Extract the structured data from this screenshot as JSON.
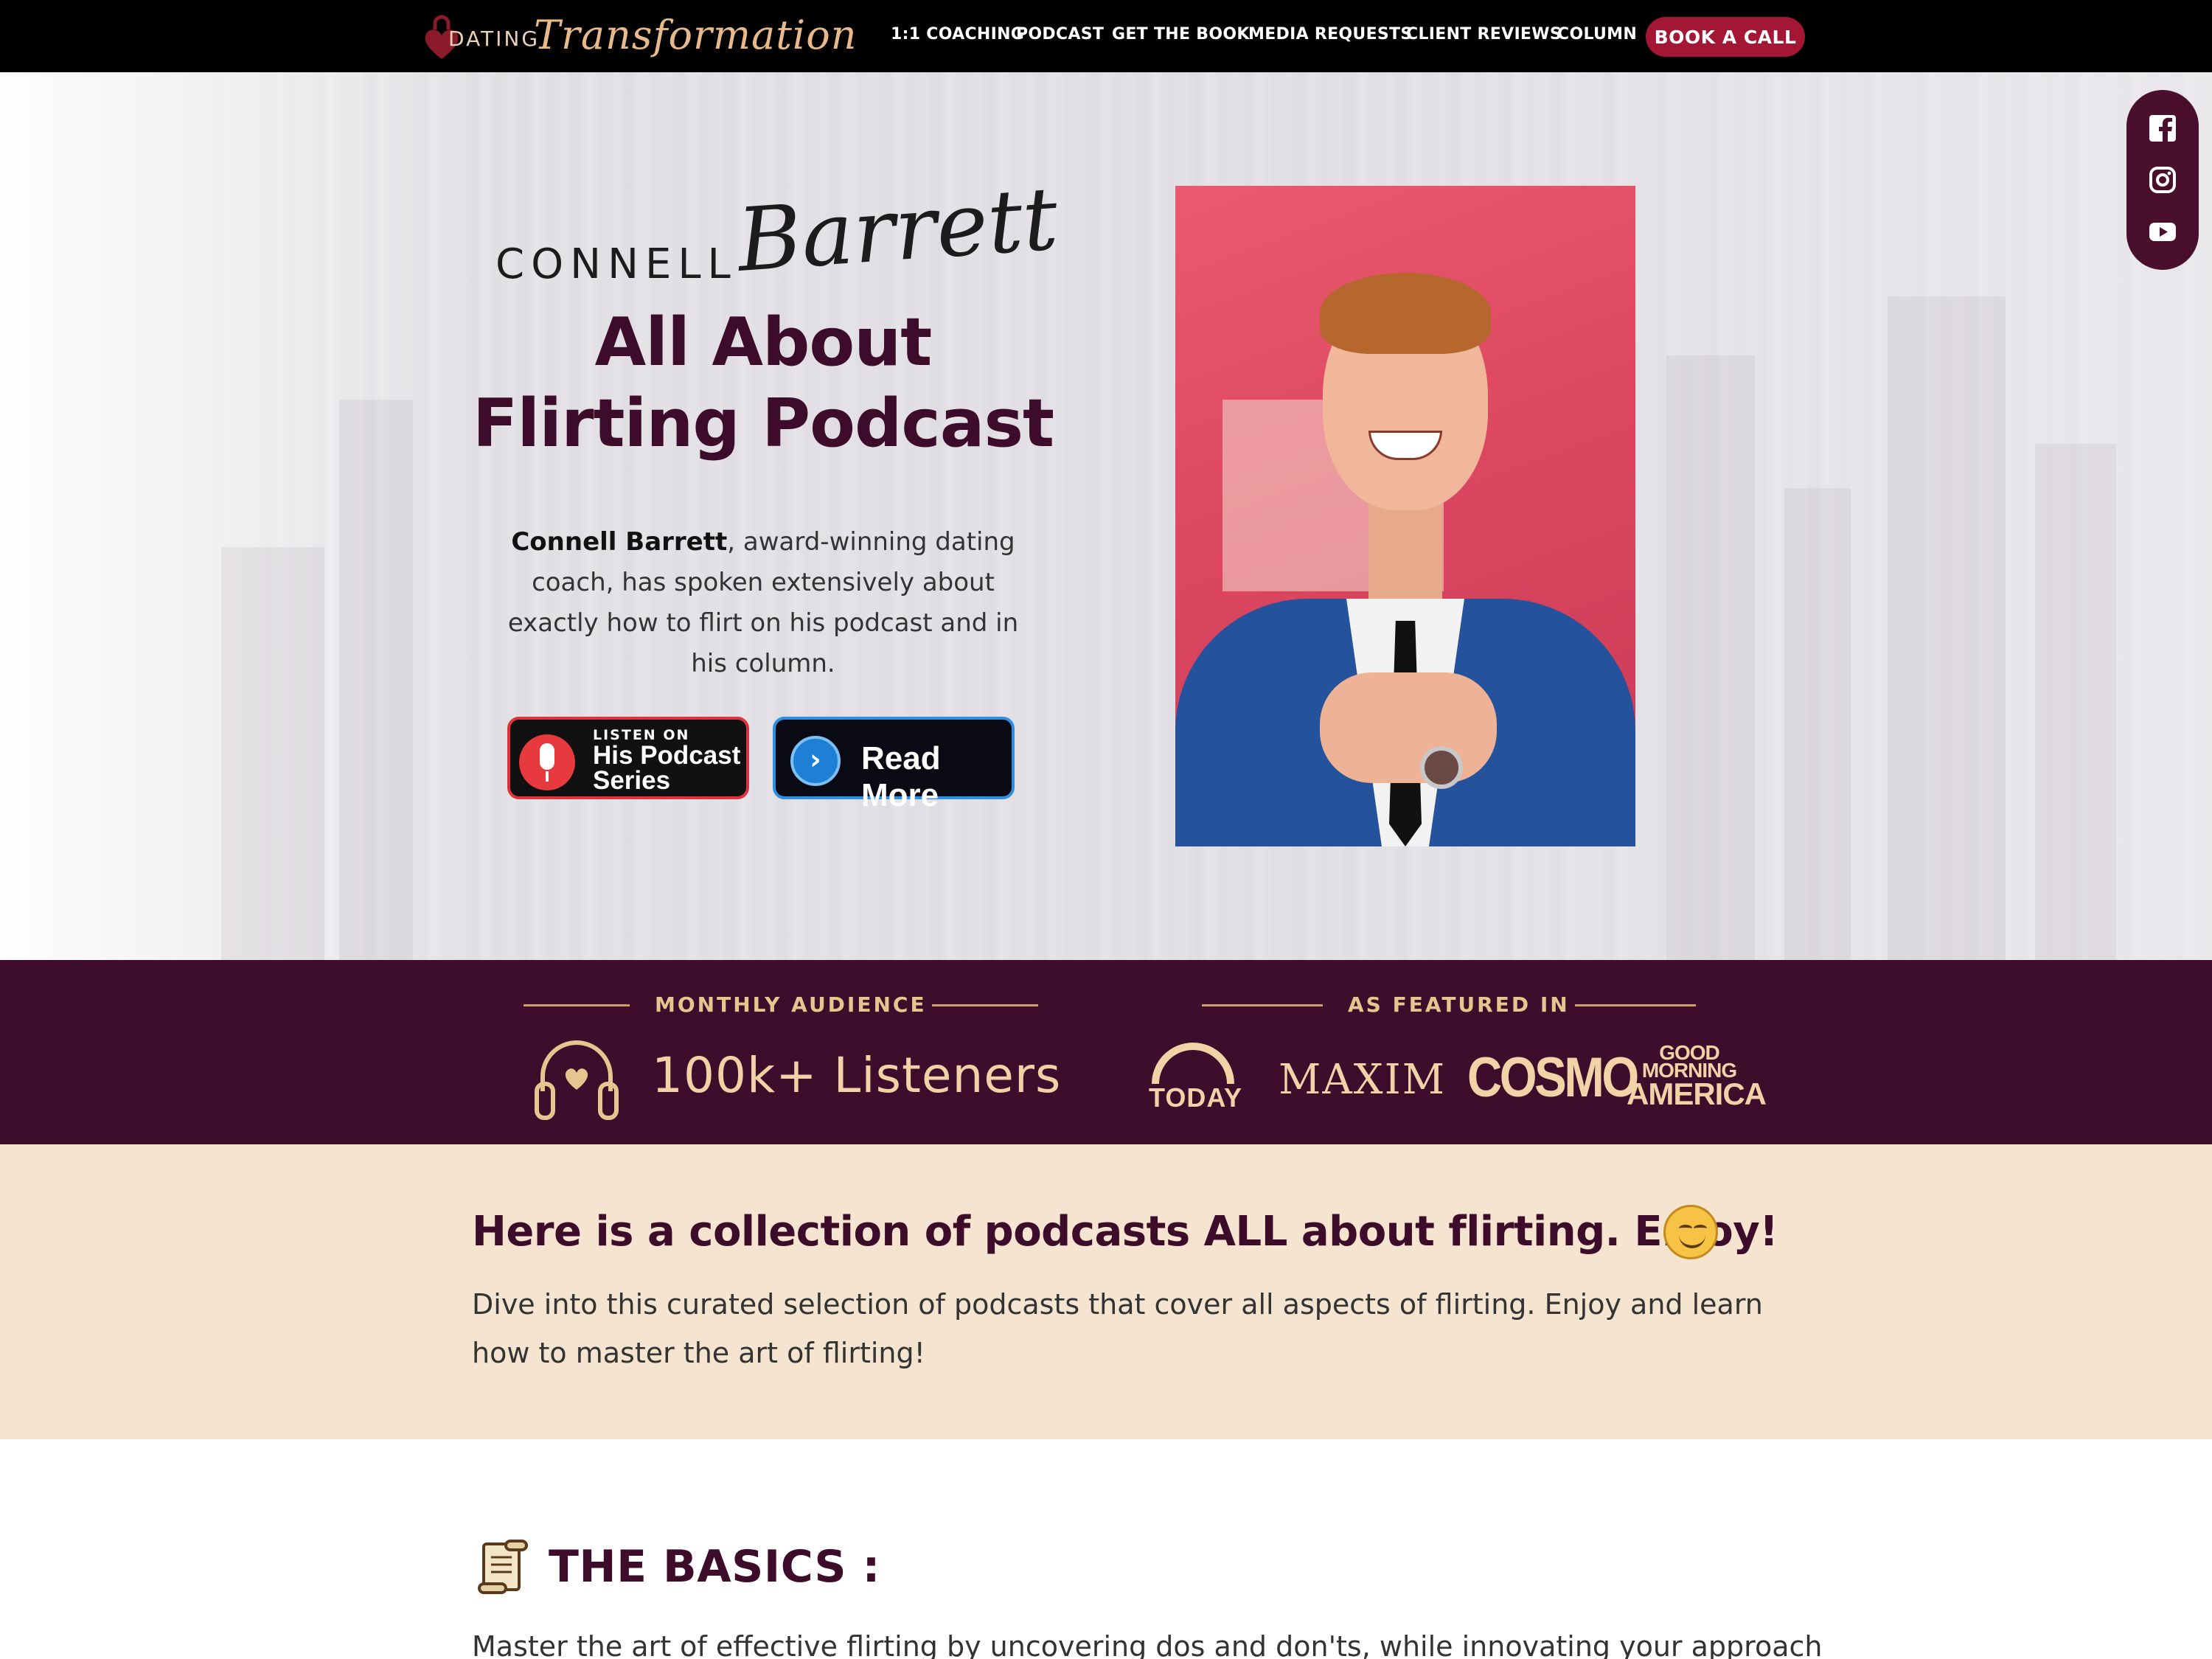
{
  "nav": {
    "logo_word": "DATING",
    "logo_script": "Transformation",
    "items": [
      {
        "label": "1:1 COACHING"
      },
      {
        "label": "PODCAST"
      },
      {
        "label": "GET THE BOOK"
      },
      {
        "label": "MEDIA REQUESTS"
      },
      {
        "label": "CLIENT REVIEWS"
      },
      {
        "label": "COLUMN"
      }
    ],
    "cta_label": "BOOK A CALL"
  },
  "hero": {
    "signature_first": "CONNELL",
    "signature_last": "Barrett",
    "title_line1": "All About",
    "title_line2": "Flirting Podcast",
    "desc_name": "Connell Barrett",
    "desc_rest": ", award-winning dating coach, has spoken extensively about exactly how to flirt on his podcast and in his column.",
    "podcast_button_small": "LISTEN ON",
    "podcast_button_big": "His Podcast Series",
    "read_more_label": "Read More"
  },
  "social": [
    "facebook-icon",
    "instagram-icon",
    "youtube-icon"
  ],
  "stats": {
    "audience_heading": "MONTHLY AUDIENCE",
    "audience_value": "100k+ Listeners",
    "featured_heading": "AS FEATURED IN",
    "logos": {
      "today": "TODAY",
      "maxim": "MAXIM",
      "cosmo": "COSMO",
      "gma_line1": "GOOD",
      "gma_line2": "MORNING",
      "gma_line3": "AMERICA"
    }
  },
  "intro": {
    "title": "Here is a collection of podcasts ALL about flirting. Enjoy!",
    "desc": "Dive into this curated selection of podcasts that cover all aspects of flirting. Enjoy and learn how to master the art of flirting!"
  },
  "basics": {
    "title": "THE BASICS :",
    "desc": "Master the art of effective flirting by uncovering dos and don'ts, while innovating your approach"
  },
  "colors": {
    "brand_plum": "#3d0c2a",
    "cta_red": "#a31634",
    "gold": "#e6c58f",
    "intro_bg": "#f4e4d0"
  }
}
